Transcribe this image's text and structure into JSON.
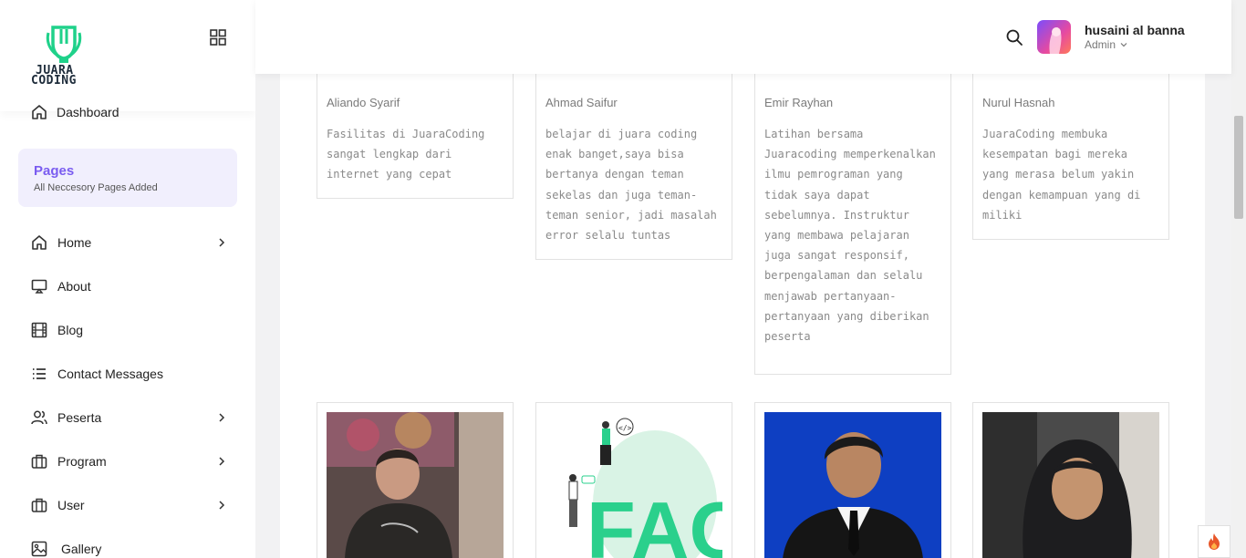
{
  "brand": {
    "logo_text_line1": "JUARA",
    "logo_text_line2": "CODING",
    "accent": "#1fd18a"
  },
  "sidebar": {
    "dashboard_label": "Dashboard",
    "pages_title": "Pages",
    "pages_subtitle": "All Neccesory Pages Added",
    "items": [
      {
        "label": "Home",
        "icon": "home-icon",
        "has_submenu": true
      },
      {
        "label": "About",
        "icon": "monitor-icon",
        "has_submenu": false
      },
      {
        "label": "Blog",
        "icon": "film-icon",
        "has_submenu": false
      },
      {
        "label": "Contact Messages",
        "icon": "list-icon",
        "has_submenu": false
      },
      {
        "label": "Peserta",
        "icon": "users-icon",
        "has_submenu": true
      },
      {
        "label": "Program",
        "icon": "briefcase-icon",
        "has_submenu": true
      },
      {
        "label": "User",
        "icon": "briefcase-icon",
        "has_submenu": true
      },
      {
        "label": "Gallery",
        "icon": "image-icon",
        "has_submenu": false
      }
    ]
  },
  "header": {
    "user_name": "husaini al banna",
    "user_role": "Admin"
  },
  "testimonials": [
    {
      "name": "Aliando Syarif",
      "text": "Fasilitas di JuaraCoding sangat lengkap dari internet yang cepat"
    },
    {
      "name": "Ahmad Saifur",
      "text": "belajar di juara coding enak banget,saya bisa bertanya dengan teman sekelas dan juga teman-teman senior, jadi masalah error selalu tuntas"
    },
    {
      "name": "Emir Rayhan",
      "text": "Latihan bersama Juaracoding memperkenalkan ilmu pemrograman yang tidak saya dapat sebelumnya. Instruktur yang membawa pelajaran juga sangat responsif, berpengalaman dan selalu menjawab pertanyaan-pertanyaan yang diberikan peserta"
    },
    {
      "name": "Nurul Hasnah",
      "text": "JuaraCoding membuka kesempatan bagi mereka yang merasa belum yakin dengan kemampuan yang di miliki"
    }
  ],
  "photos": {
    "faq_label": "FAQ",
    "code_tag": "</>"
  }
}
